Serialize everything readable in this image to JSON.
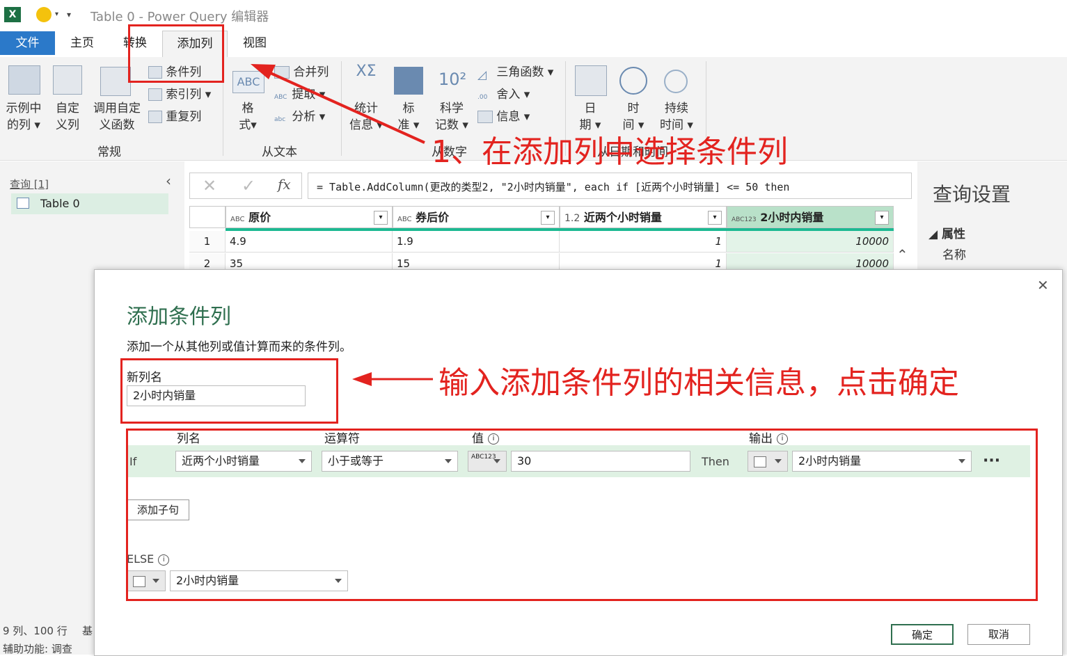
{
  "titlebar": {
    "title": "Table 0 - Power Query 编辑器"
  },
  "tabs": {
    "file": "文件",
    "home": "主页",
    "transform": "转换",
    "addcol": "添加列",
    "view": "视图"
  },
  "ribbon": {
    "example_col": [
      "示例中",
      "的列"
    ],
    "custom_col": [
      "自定",
      "义列"
    ],
    "invoke_func": [
      "调用自定",
      "义函数"
    ],
    "conditional_col": "条件列",
    "index_col": "索引列",
    "duplicate_col": "重复列",
    "group_general": "常规",
    "format": [
      "格",
      "式"
    ],
    "merge_cols": "合并列",
    "extract": "提取",
    "parse": "分析",
    "group_text": "从文本",
    "statistics": [
      "统计",
      "信息"
    ],
    "standard": [
      "标",
      "准"
    ],
    "scientific": [
      "科学",
      "记数"
    ],
    "trig": "三角函数",
    "rounding": "舍入",
    "information": "信息",
    "group_number": "从数字",
    "date": [
      "日",
      "期"
    ],
    "time": [
      "时",
      "间"
    ],
    "duration": [
      "持续",
      "时间"
    ],
    "group_datetime": "从日期和时间"
  },
  "left": {
    "queries_label": "查询 [1]",
    "query_item": "Table 0",
    "status_cols": "9 列、100 行",
    "status_extra": "基",
    "accessibility": "辅助功能: 调查"
  },
  "formula": {
    "text": "= Table.AddColumn(更改的类型2, \"2小时内销量\", each if [近两个小时销量] <= 50 then"
  },
  "grid": {
    "columns": [
      {
        "type_icon": "ABC",
        "name": "原价"
      },
      {
        "type_icon": "ABC",
        "name": "券后价"
      },
      {
        "type_icon": "1.2",
        "name": "近两个小时销量"
      },
      {
        "type_icon": "ABC123",
        "name": "2小时内销量"
      }
    ],
    "rows": [
      [
        "1",
        "4.9",
        "1.9",
        "1",
        "10000"
      ],
      [
        "2",
        "35",
        "15",
        "1",
        "10000"
      ]
    ]
  },
  "right": {
    "title": "查询设置",
    "props": "属性",
    "name_label": "名称"
  },
  "dialog": {
    "title": "添加条件列",
    "subtitle": "添加一个从其他列或值计算而来的条件列。",
    "new_col_label": "新列名",
    "new_col_value": "2小时内销量",
    "hdr_colname": "列名",
    "hdr_operator": "运算符",
    "hdr_value": "值",
    "hdr_output": "输出",
    "if_label": "If",
    "if_col": "近两个小时销量",
    "if_op": "小于或等于",
    "value_type": "ABC123",
    "if_value": "30",
    "then_label": "Then",
    "then_output": "2小时内销量",
    "more": "···",
    "add_clause": "添加子句",
    "else_label": "ELSE",
    "else_output": "2小时内销量",
    "ok": "确定",
    "cancel": "取消",
    "close": "✕"
  },
  "annotations": {
    "step1": "1、在添加列中选择条件列",
    "step2": "输入添加条件列的相关信息，点击确定"
  },
  "colors": {
    "accent": "#2b79c9",
    "annotation_red": "#e3231f",
    "selected_col": "#d7eee0",
    "condition_row": "#dff1e3"
  }
}
